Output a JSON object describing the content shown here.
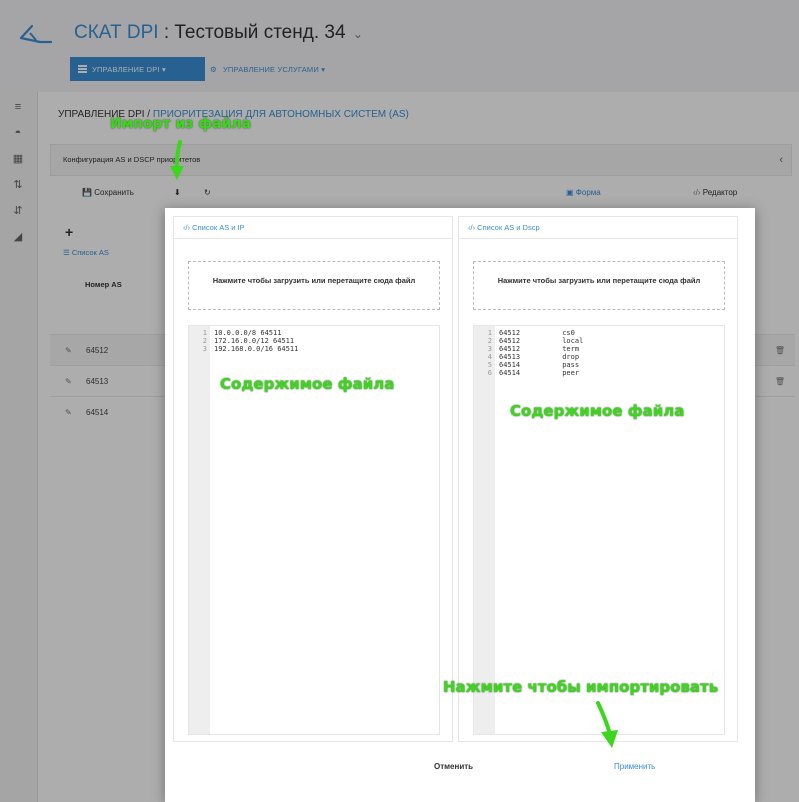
{
  "header": {
    "brand": "СКАТ DPI",
    "separator": " : ",
    "stand": "Тестовый стенд. 34",
    "caret": "⌄",
    "menu_primary": "УПРАВЛЕНИЕ DPI ▾",
    "menu_secondary": "УПРАВЛЕНИЕ УСЛУГАМИ ▾"
  },
  "breadcrumb": {
    "root": "УПРАВЛЕНИЕ DPI / ",
    "current": "ПРИОРИТЕЗАЦИЯ ДЛЯ АВТОНОМНЫХ СИСТЕМ (AS)"
  },
  "config_bar": {
    "label": "Конфигурация AS и DSCP приоритетов",
    "chevron": "‹"
  },
  "toolbar": {
    "save_label": "Сохранить",
    "save_icon": "💾",
    "import_icon": "⬇",
    "reload_icon": "↻",
    "form_label": "Форма",
    "form_icon": "▣",
    "editor_label": "Редактор",
    "editor_icon": "‹/›"
  },
  "add_icon": "+",
  "as_list_label": "Список AS",
  "table": {
    "column_header": "Номер AS",
    "rows": [
      "64512",
      "64513",
      "64514"
    ]
  },
  "modal": {
    "left_panel": {
      "title": "‹/›  Список AS и IP",
      "dropzone": "Нажмите чтобы загрузить или перетащите сюда файл",
      "lines": [
        "1",
        "2",
        "3"
      ],
      "code": [
        "10.0.0.0/8 64511",
        "172.16.0.0/12 64511",
        "192.168.0.0/16 64511"
      ]
    },
    "right_panel": {
      "title": "‹/›  Список AS и Dscp",
      "dropzone": "Нажмите чтобы загрузить или перетащите сюда файл",
      "lines": [
        "1",
        "2",
        "3",
        "4",
        "5",
        "6"
      ],
      "code": [
        "64512          cs0",
        "64512          local",
        "64512          term",
        "64513          drop",
        "64514          pass",
        "64514          peer"
      ]
    },
    "cancel_label": "Отменить",
    "apply_label": "Применить"
  },
  "annotations": {
    "import": "Импорт из файла",
    "content_left": "Содержимое файла",
    "content_right": "Содержимое файла",
    "apply_hint": "Нажмите чтобы импортировать"
  },
  "colors": {
    "accent": "#3a8fd6",
    "annotation": "#3ed51f"
  }
}
